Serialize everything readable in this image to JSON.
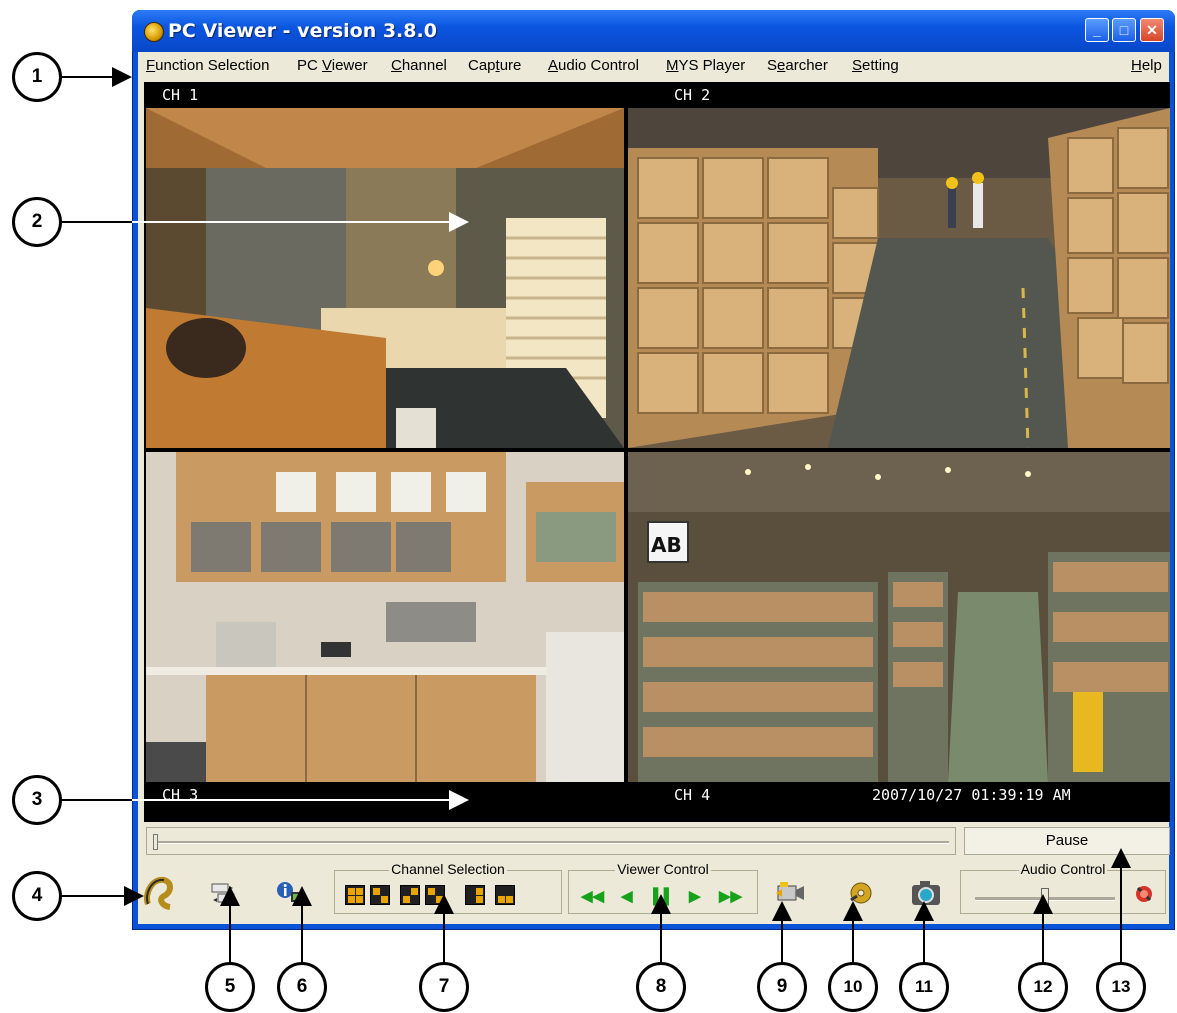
{
  "window": {
    "title": "PC Viewer - version 3.8.0",
    "minimize_glyph": "_",
    "maximize_glyph": "□",
    "close_glyph": "✕"
  },
  "menu": {
    "items": [
      {
        "pre": "",
        "key": "F",
        "post": "unction Selection"
      },
      {
        "pre": "PC ",
        "key": "V",
        "post": "iewer"
      },
      {
        "pre": "",
        "key": "C",
        "post": "hannel"
      },
      {
        "pre": "Cap",
        "key": "t",
        "post": "ure"
      },
      {
        "pre": "",
        "key": "A",
        "post": "udio Control"
      },
      {
        "pre": "",
        "key": "M",
        "post": "YS Player"
      },
      {
        "pre": "S",
        "key": "e",
        "post": "archer"
      },
      {
        "pre": "",
        "key": "S",
        "post": "etting"
      },
      {
        "pre": "",
        "key": "H",
        "post": "elp"
      }
    ]
  },
  "channels": {
    "ch1": "CH 1",
    "ch2": "CH 2",
    "ch3": "CH 3",
    "ch4": "CH 4",
    "timestamp": "2007/10/27 01:39:19 AM"
  },
  "playback": {
    "pause_label": "Pause",
    "progress_fraction": 0.0
  },
  "toolbar": {
    "channel_selection_label": "Channel Selection",
    "viewer_control_label": "Viewer Control",
    "audio_control_label": "Audio Control",
    "viewer_controls": [
      "◀◀",
      "◀",
      "▌▌",
      "▶",
      "▶▶"
    ],
    "volume_fraction": 0.5
  },
  "icons": {
    "logo": "logo-icon",
    "switch": "switch-icon",
    "info": "info-icon",
    "record": "record-icon",
    "disc": "disc-icon",
    "snapshot": "camera-icon",
    "mute": "mute-icon"
  },
  "callouts": [
    "1",
    "2",
    "3",
    "4",
    "5",
    "6",
    "7",
    "8",
    "9",
    "10",
    "11",
    "12",
    "13"
  ],
  "colors": {
    "titlebar": "#0c56e0",
    "window_bg": "#ece9d8",
    "video_bg": "#000000",
    "control_green": "#17a21b"
  }
}
